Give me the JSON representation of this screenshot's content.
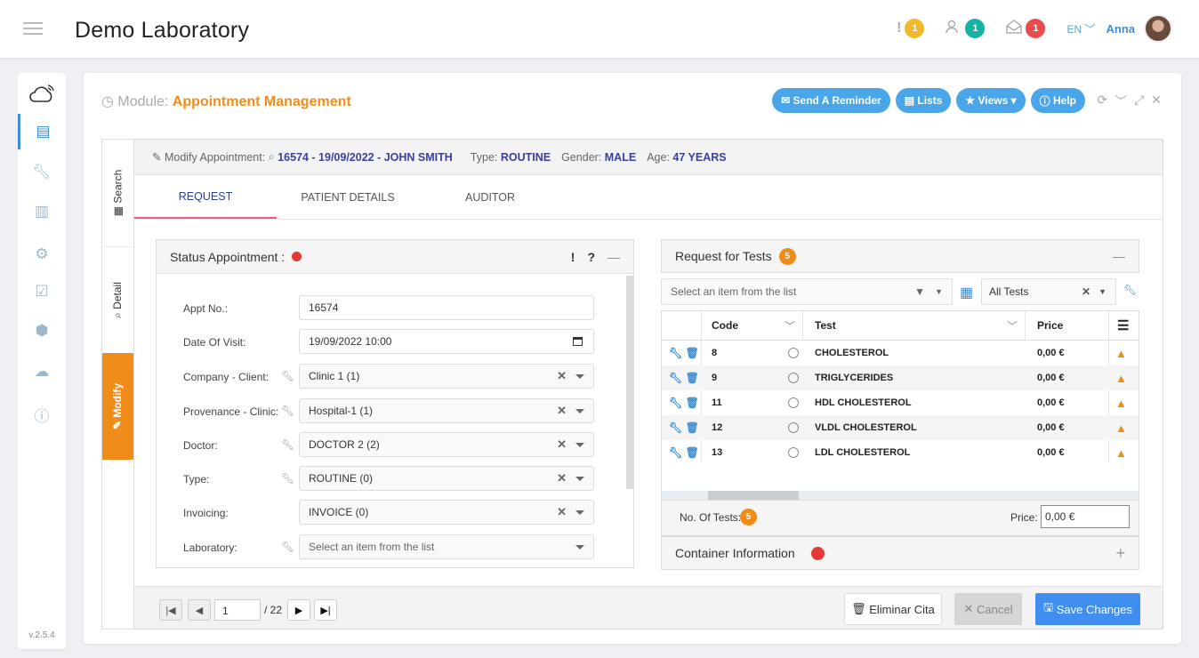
{
  "app": {
    "title": "Demo Laboratory",
    "version": "v.2.5.4"
  },
  "header": {
    "notifications": [
      {
        "icon": "exclamation-icon",
        "count": "1",
        "color": "#f3b72a"
      },
      {
        "icon": "users-icon",
        "count": "1",
        "color": "#16b3a3"
      },
      {
        "icon": "envelope-open-icon",
        "count": "1",
        "color": "#e84c4c"
      }
    ],
    "language": "EN",
    "user": "Anna"
  },
  "module": {
    "prefix": "Module:",
    "name": "Appointment Management",
    "buttons": {
      "reminder": "Send A Reminder",
      "lists": "Lists",
      "views": "Views",
      "help": "Help"
    }
  },
  "vtabs": {
    "search": "Search",
    "detail": "Detail",
    "modify": "Modify"
  },
  "modify_bar": {
    "label": "Modify Appointment:",
    "appointment": "16574 - 19/09/2022 - JOHN SMITH",
    "type_label": "Type:",
    "type": "ROUTINE",
    "gender_label": "Gender:",
    "gender": "MALE",
    "age_label": "Age:",
    "age": "47 YEARS"
  },
  "tabs": [
    "REQUEST",
    "PATIENT DETAILS",
    "AUDITOR"
  ],
  "status_panel": {
    "title": "Status Appointment :",
    "fields": [
      {
        "label": "Appt No.:",
        "value": "16574"
      },
      {
        "label": "Date Of Visit:",
        "value": "19/09/2022 10:00"
      },
      {
        "label": "Company - Client:",
        "value": "Clinic 1 (1)"
      },
      {
        "label": "Provenance - Clinic:",
        "value": "Hospital-1 (1)"
      },
      {
        "label": "Doctor:",
        "value": "DOCTOR 2 (2)"
      },
      {
        "label": "Type:",
        "value": "ROUTINE (0)"
      },
      {
        "label": "Invoicing:",
        "value": "INVOICE (0)"
      },
      {
        "label": "Laboratory:",
        "value": "Select an item from the list"
      }
    ]
  },
  "tests_panel": {
    "title": "Request for Tests",
    "count": "5",
    "filter_placeholder": "Select an item from the list",
    "filter_all": "All Tests",
    "columns": {
      "code": "Code",
      "test": "Test",
      "price": "Price"
    },
    "rows": [
      {
        "code": "8",
        "test": "CHOLESTEROL",
        "price": "0,00 €"
      },
      {
        "code": "9",
        "test": "TRIGLYCERIDES",
        "price": "0,00 €"
      },
      {
        "code": "11",
        "test": "HDL CHOLESTEROL",
        "price": "0,00 €"
      },
      {
        "code": "12",
        "test": "VLDL CHOLESTEROL",
        "price": "0,00 €"
      },
      {
        "code": "13",
        "test": "LDL CHOLESTEROL",
        "price": "0,00 €"
      }
    ],
    "no_tests_label": "No. Of Tests:",
    "no_tests": "5",
    "price_label": "Price:",
    "price_value": "0,00 €"
  },
  "container_panel": {
    "title": "Container Information"
  },
  "pager": {
    "page": "1",
    "total": "/ 22"
  },
  "footer": {
    "delete": "Eliminar Cita",
    "cancel": "Cancel",
    "save": "Save Changes"
  }
}
